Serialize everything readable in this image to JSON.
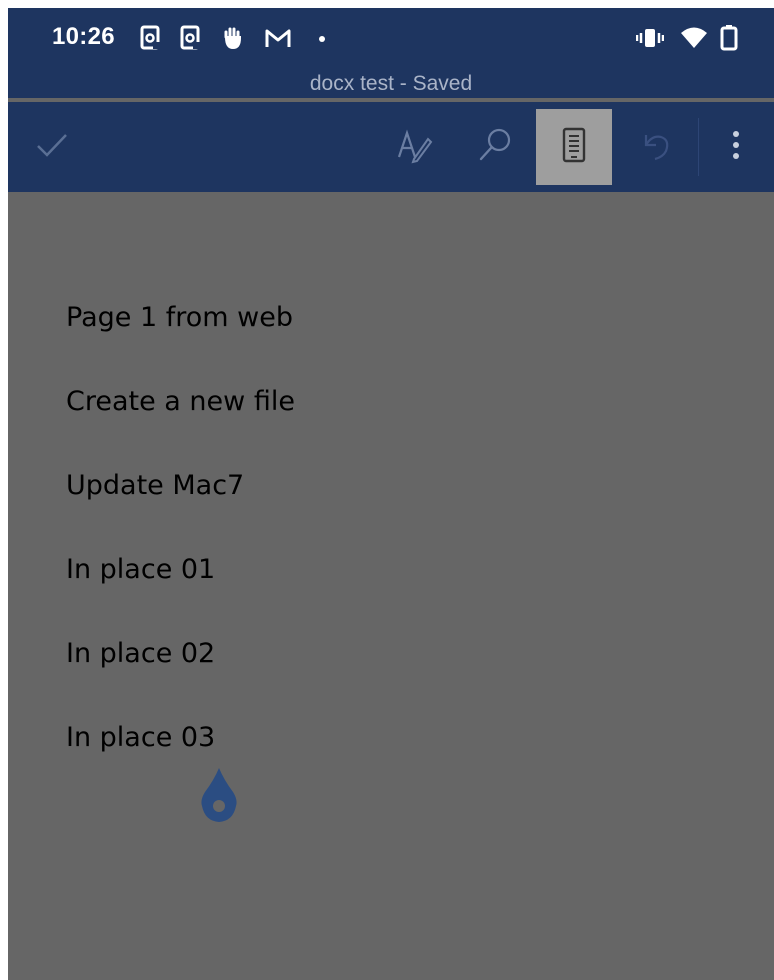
{
  "status_bar": {
    "time": "10:26",
    "left_icons": [
      "screenshot-icon",
      "screenshot-icon",
      "touch-hand-icon",
      "gmail-icon",
      "dot-icon"
    ],
    "right_icons": [
      "vibrate-icon",
      "wifi-icon",
      "battery-icon"
    ]
  },
  "document_title": "docx test - Saved",
  "toolbar": {
    "buttons": [
      "checkmark-icon",
      "draw-pen-icon",
      "search-icon",
      "mobile-view-icon",
      "undo-icon",
      "more-vert-icon"
    ],
    "active_button": "mobile-view-icon"
  },
  "document": {
    "lines": [
      "Page 1 from web",
      "Create a new file",
      "Update Mac7",
      "In place 01",
      "In place 02",
      "In place 03"
    ]
  },
  "colors": {
    "app_bar": "#1e3560",
    "dim_overlay": "#666666",
    "cursor_handle": "#2b4d82"
  }
}
